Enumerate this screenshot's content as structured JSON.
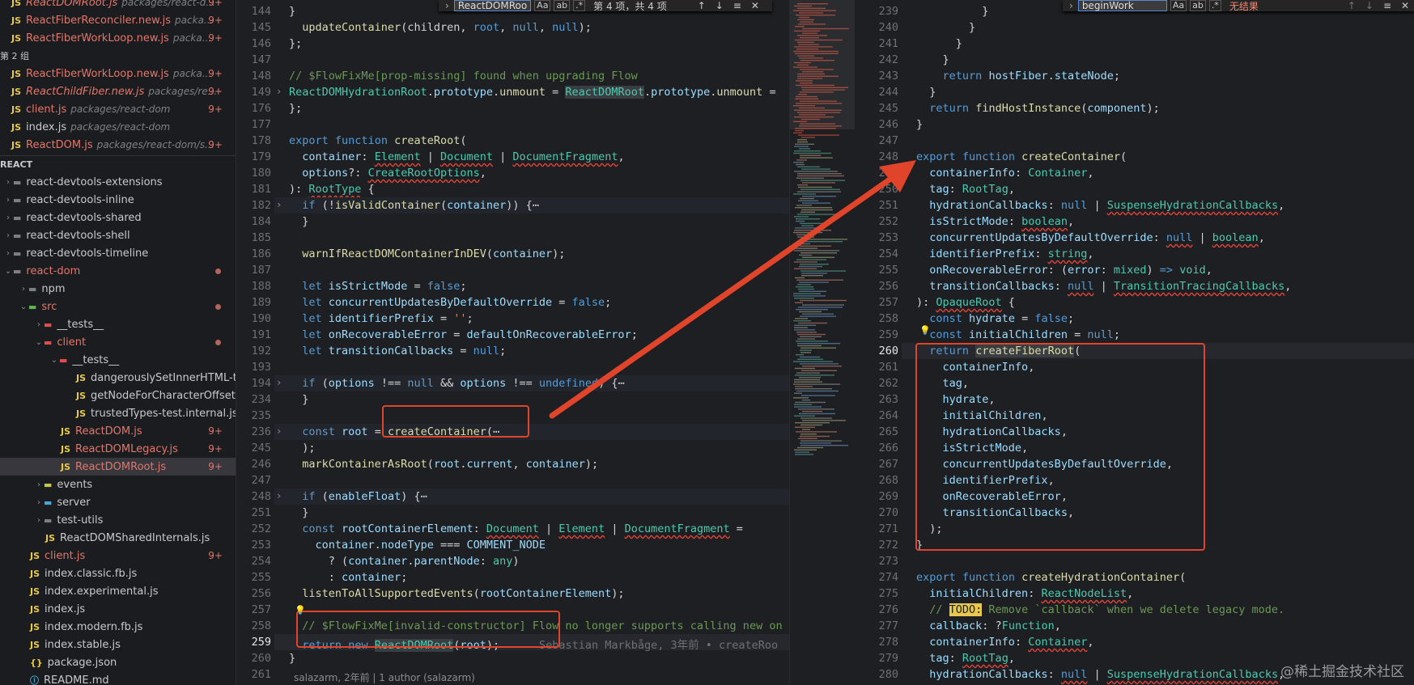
{
  "sidebar": {
    "open_editors": [
      {
        "name": "ReactDOMRoot.js",
        "desc": "packages/react-d...",
        "badge": "9+",
        "mod": true,
        "italic": true
      },
      {
        "name": "ReactFiberReconciler.new.js",
        "desc": "packa...",
        "badge": "9+",
        "mod": true
      },
      {
        "name": "ReactFiberWorkLoop.new.js",
        "desc": "packa...",
        "badge": "9+",
        "mod": true
      }
    ],
    "group_label": "第 2 组",
    "group2_files": [
      {
        "name": "ReactFiberWorkLoop.new.js",
        "desc": "packa...",
        "badge": "9+",
        "mod": true
      },
      {
        "name": "ReactChildFiber.new.js",
        "desc": "packages/re...",
        "badge": "9+",
        "mod": true,
        "italic": true
      },
      {
        "name": "client.js",
        "desc": "packages/react-dom",
        "badge": "9+",
        "mod": true
      },
      {
        "name": "index.js",
        "desc": "packages/react-dom",
        "badge": "",
        "mod": false
      },
      {
        "name": "ReactDOM.js",
        "desc": "packages/react-dom/s...",
        "badge": "9+",
        "mod": true
      }
    ],
    "project_label": "REACT",
    "tree": [
      {
        "name": "react-devtools-extensions",
        "depth": 0,
        "kind": "folder",
        "open": false
      },
      {
        "name": "react-devtools-inline",
        "depth": 0,
        "kind": "folder",
        "open": false
      },
      {
        "name": "react-devtools-shared",
        "depth": 0,
        "kind": "folder",
        "open": false
      },
      {
        "name": "react-devtools-shell",
        "depth": 0,
        "kind": "folder",
        "open": false
      },
      {
        "name": "react-devtools-timeline",
        "depth": 0,
        "kind": "folder",
        "open": false
      },
      {
        "name": "react-dom",
        "depth": 0,
        "kind": "folder",
        "open": true,
        "mod": true,
        "dot": true
      },
      {
        "name": "npm",
        "depth": 1,
        "kind": "folder",
        "open": false
      },
      {
        "name": "src",
        "depth": 1,
        "kind": "folder-src",
        "open": true,
        "mod": true,
        "dot": true
      },
      {
        "name": "__tests__",
        "depth": 2,
        "kind": "folder-test",
        "open": false
      },
      {
        "name": "client",
        "depth": 2,
        "kind": "folder-client",
        "open": true,
        "mod": true,
        "dot": true
      },
      {
        "name": "__tests__",
        "depth": 3,
        "kind": "folder-test",
        "open": true
      },
      {
        "name": "dangerouslySetInnerHTML-test.js",
        "depth": 4,
        "kind": "js"
      },
      {
        "name": "getNodeForCharacterOffset-test.js",
        "depth": 4,
        "kind": "js"
      },
      {
        "name": "trustedTypes-test.internal.js",
        "depth": 4,
        "kind": "js"
      },
      {
        "name": "ReactDOM.js",
        "depth": 3,
        "kind": "js",
        "mod": true,
        "badge": "9+"
      },
      {
        "name": "ReactDOMLegacy.js",
        "depth": 3,
        "kind": "js",
        "mod": true,
        "badge": "9+"
      },
      {
        "name": "ReactDOMRoot.js",
        "depth": 3,
        "kind": "js",
        "mod": true,
        "badge": "9+",
        "selected": true
      },
      {
        "name": "events",
        "depth": 2,
        "kind": "folder-events",
        "open": false
      },
      {
        "name": "server",
        "depth": 2,
        "kind": "folder-server",
        "open": false
      },
      {
        "name": "test-utils",
        "depth": 2,
        "kind": "folder",
        "open": false
      },
      {
        "name": "ReactDOMSharedInternals.js",
        "depth": 2,
        "kind": "js"
      },
      {
        "name": "client.js",
        "depth": 1,
        "kind": "js",
        "mod": true,
        "badge": "9+"
      },
      {
        "name": "index.classic.fb.js",
        "depth": 1,
        "kind": "js"
      },
      {
        "name": "index.experimental.js",
        "depth": 1,
        "kind": "js"
      },
      {
        "name": "index.js",
        "depth": 1,
        "kind": "js"
      },
      {
        "name": "index.modern.fb.js",
        "depth": 1,
        "kind": "js"
      },
      {
        "name": "index.stable.js",
        "depth": 1,
        "kind": "js"
      },
      {
        "name": "package.json",
        "depth": 1,
        "kind": "json"
      },
      {
        "name": "README.md",
        "depth": 1,
        "kind": "md"
      }
    ]
  },
  "find1": {
    "query": "ReactDOMRoo",
    "count": "第 4 项，共 4 项",
    "opt_case": "Aa",
    "opt_word": "ab",
    "opt_regex": ".*"
  },
  "find2": {
    "query": "beginWork",
    "count": "无结果",
    "opt_case": "Aa",
    "opt_word": "ab",
    "opt_regex": ".*"
  },
  "editor1": {
    "lines": [
      {
        "n": "144",
        "html": "}"
      },
      {
        "n": "145",
        "html": "  <span class='f'>updateContainer</span>(children, <span class='k'>root</span>, <span class='k'>null</span>, <span class='k'>null</span>);"
      },
      {
        "n": "146",
        "html": "};"
      },
      {
        "n": "147",
        "html": ""
      },
      {
        "n": "148",
        "html": "<span class='c'>// $FlowFixMe[prop-missing] found when upgrading Flow</span>"
      },
      {
        "n": "149",
        "html": "<span class='t'>ReactDOMHydrationRoot</span>.<span class='v'>prototype</span>.<span class='f'>unmount</span> = <span class='t hl'>ReactDOMRoot</span>.<span class='v'>prototype</span>.<span class='f'>unmount</span> =",
        "fold": true
      },
      {
        "n": "176",
        "html": "};"
      },
      {
        "n": "177",
        "html": ""
      },
      {
        "n": "178",
        "html": "<span class='k'>export</span> <span class='k'>function</span> <span class='f'>createRoot</span>("
      },
      {
        "n": "179",
        "html": "  <span class='v'>container</span>: <span class='t u'>Element</span> | <span class='t u'>Document</span> | <span class='t u'>DocumentFragment</span>,"
      },
      {
        "n": "180",
        "html": "  <span class='v'>options</span>?: <span class='t u'>CreateRootOptions</span>,"
      },
      {
        "n": "181",
        "html": "): <span class='t u'>RootType</span> {"
      },
      {
        "n": "182",
        "html": "  <span class='k'>if</span> (!<span class='f'>isValidContainer</span>(<span class='v'>container</span>)) {<span class='o'>⋯</span>",
        "fold": true,
        "bg": true
      },
      {
        "n": "184",
        "html": "  }"
      },
      {
        "n": "185",
        "html": ""
      },
      {
        "n": "186",
        "html": "  <span class='f'>warnIfReactDOMContainerInDEV</span>(<span class='v'>container</span>);"
      },
      {
        "n": "187",
        "html": ""
      },
      {
        "n": "188",
        "html": "  <span class='k'>let</span> <span class='v'>isStrictMode</span> = <span class='k'>false</span>;"
      },
      {
        "n": "189",
        "html": "  <span class='k'>let</span> <span class='v'>concurrentUpdatesByDefaultOverride</span> = <span class='k'>false</span>;"
      },
      {
        "n": "190",
        "html": "  <span class='k'>let</span> <span class='v'>identifierPrefix</span> = <span class='s'>''</span>;"
      },
      {
        "n": "191",
        "html": "  <span class='k'>let</span> <span class='v'>onRecoverableError</span> = <span class='v'>defaultOnRecoverableError</span>;"
      },
      {
        "n": "192",
        "html": "  <span class='k'>let</span> <span class='v'>transitionCallbacks</span> = <span class='k'>null</span>;"
      },
      {
        "n": "193",
        "html": ""
      },
      {
        "n": "194",
        "html": "  <span class='k'>if</span> (<span class='v'>options</span> !== <span class='k'>null</span> &amp;&amp; <span class='v'>options</span> !== <span class='k'>undefined</span>) {<span class='o'>⋯</span>",
        "fold": true,
        "bg": true
      },
      {
        "n": "234",
        "html": "  }"
      },
      {
        "n": "235",
        "html": ""
      },
      {
        "n": "236",
        "html": "  <span class='k'>const</span> <span class='v'>root</span> = <span class='f'>createContainer</span>(<span class='o'>⋯</span>",
        "fold": true,
        "bg": true
      },
      {
        "n": "245",
        "html": "  );"
      },
      {
        "n": "246",
        "html": "  <span class='f'>markContainerAsRoot</span>(<span class='v'>root</span>.<span class='v'>current</span>, <span class='v'>container</span>);"
      },
      {
        "n": "247",
        "html": ""
      },
      {
        "n": "248",
        "html": "  <span class='k'>if</span> (<span class='v'>enableFloat</span>) {<span class='o'>⋯</span>",
        "fold": true,
        "bg": true
      },
      {
        "n": "251",
        "html": "  }"
      },
      {
        "n": "252",
        "html": "  <span class='k'>const</span> <span class='v'>rootContainerElement</span>: <span class='t u'>Document</span> | <span class='t u'>Element</span> | <span class='t u'>DocumentFragment</span> ="
      },
      {
        "n": "253",
        "html": "    <span class='v'>container</span>.<span class='v'>nodeType</span> === <span class='v'>COMMENT_NODE</span>"
      },
      {
        "n": "254",
        "html": "      ? (<span class='v'>container</span>.<span class='v'>parentNode</span>: <span class='t'>any</span>)"
      },
      {
        "n": "255",
        "html": "      : <span class='v'>container</span>;"
      },
      {
        "n": "256",
        "html": "  <span class='f'>listenToAllSupportedEvents</span>(<span class='v'>rootContainerElement</span>);"
      },
      {
        "n": "257",
        "html": ""
      },
      {
        "n": "258",
        "html": "<span class='c'>  // $FlowFixMe[invalid-constructor] Flow no longer supports calling new on</span>"
      },
      {
        "n": "259",
        "html": "  <span class='k'>return</span> <span class='k'>new</span> <span class='t hl'>ReactDOMRoot</span>(<span class='v'>root</span>);      <span style='color:#6e7076'>Sebastian Markbåge, 3年前 • createRoo</span>",
        "active": true
      },
      {
        "n": "260",
        "html": "}"
      },
      {
        "n": "261",
        "html": ""
      }
    ],
    "author_line": "salazarm, 2年前 | 1 author (salazarm)"
  },
  "editor2": {
    "lines": [
      {
        "n": "239",
        "html": "          }"
      },
      {
        "n": "240",
        "html": "        }"
      },
      {
        "n": "241",
        "html": "      }"
      },
      {
        "n": "242",
        "html": "    }"
      },
      {
        "n": "243",
        "html": "    <span class='k'>return</span> <span class='v'>hostFiber</span>.<span class='v'>stateNode</span>;"
      },
      {
        "n": "244",
        "html": "  }"
      },
      {
        "n": "245",
        "html": "  <span class='k'>return</span> <span class='f'>findHostInstance</span>(<span class='v'>component</span>);"
      },
      {
        "n": "246",
        "html": "}"
      },
      {
        "n": "247",
        "html": ""
      },
      {
        "n": "248",
        "html": "<span class='k'>export</span> <span class='k'>function</span> <span class='f'>createContainer</span>("
      },
      {
        "n": "249",
        "html": "  <span class='v'>containerInfo</span>: <span class='t'>Container</span>,"
      },
      {
        "n": "250",
        "html": "  <span class='v'>tag</span>: <span class='t'>RootTag</span>,"
      },
      {
        "n": "251",
        "html": "  <span class='v'>hydrationCallbacks</span>: <span class='k'>null</span> | <span class='t u'>SuspenseHydrationCallbacks</span>,"
      },
      {
        "n": "252",
        "html": "  <span class='v'>isStrictMode</span>: <span class='t u'>boolean</span>,"
      },
      {
        "n": "253",
        "html": "  <span class='v'>concurrentUpdatesByDefaultOverride</span>: <span class='k u'>null</span> | <span class='t u'>boolean</span>,"
      },
      {
        "n": "254",
        "html": "  <span class='v'>identifierPrefix</span>: <span class='t u'>string</span>,"
      },
      {
        "n": "255",
        "html": "  <span class='v'>onRecoverableError</span>: (<span class='v'>error</span>: <span class='t'>mixed</span>) <span class='k'>=&gt;</span> <span class='t'>void</span>,"
      },
      {
        "n": "256",
        "html": "  <span class='v'>transitionCallbacks</span>: <span class='k u'>null</span> | <span class='t u'>TransitionTracingCallbacks</span>,"
      },
      {
        "n": "257",
        "html": "): <span class='t u'>OpaqueRoot</span> {"
      },
      {
        "n": "258",
        "html": "  <span class='k'>const</span> <span class='v'>hydrate</span> = <span class='k'>false</span>;"
      },
      {
        "n": "259",
        "html": "  <span class='k'>const</span> <span class='v'>initialChildren</span> = <span class='k'>null</span>;"
      },
      {
        "n": "260",
        "html": "  <span class='k'>return</span> <span class='f hl'>createFiberRoot</span>(",
        "active": true
      },
      {
        "n": "261",
        "html": "    <span class='v'>containerInfo</span>,"
      },
      {
        "n": "262",
        "html": "    <span class='v'>tag</span>,"
      },
      {
        "n": "263",
        "html": "    <span class='v'>hydrate</span>,"
      },
      {
        "n": "264",
        "html": "    <span class='v'>initialChildren</span>,"
      },
      {
        "n": "265",
        "html": "    <span class='v'>hydrationCallbacks</span>,"
      },
      {
        "n": "266",
        "html": "    <span class='v'>isStrictMode</span>,"
      },
      {
        "n": "267",
        "html": "    <span class='v'>concurrentUpdatesByDefaultOverride</span>,"
      },
      {
        "n": "268",
        "html": "    <span class='v'>identifierPrefix</span>,"
      },
      {
        "n": "269",
        "html": "    <span class='v'>onRecoverableError</span>,"
      },
      {
        "n": "270",
        "html": "    <span class='v'>transitionCallbacks</span>,"
      },
      {
        "n": "271",
        "html": "  );"
      },
      {
        "n": "272",
        "html": "}"
      },
      {
        "n": "273",
        "html": ""
      },
      {
        "n": "274",
        "html": "<span class='k'>export</span> <span class='k'>function</span> <span class='f'>createHydrationContainer</span>("
      },
      {
        "n": "275",
        "html": "  <span class='v'>initialChildren</span>: <span class='t u'>ReactNodeList</span>,"
      },
      {
        "n": "276",
        "html": "  <span class='c'>// </span><span style='background:#e8c94d;color:#1e1f22'>TODO:</span><span class='c'> Remove `callback` when we delete legacy mode.</span>"
      },
      {
        "n": "277",
        "html": "  <span class='v'>callback</span>: ?<span class='t'>Function</span>,"
      },
      {
        "n": "278",
        "html": "  <span class='v'>containerInfo</span>: <span class='t u'>Container</span>,"
      },
      {
        "n": "279",
        "html": "  <span class='v'>tag</span>: <span class='t u'>RootTag</span>,"
      },
      {
        "n": "280",
        "html": "  <span class='v'>hydrationCallbacks</span>: <span class='k u'>null</span> | <span class='t u'>SuspenseHydrationCallbacks</span>,"
      }
    ]
  },
  "watermark": "@稀土掘金技术社区",
  "colors": {
    "accent_red": "#e0442a",
    "modified": "#e2776a",
    "bg": "#1e1f22"
  }
}
